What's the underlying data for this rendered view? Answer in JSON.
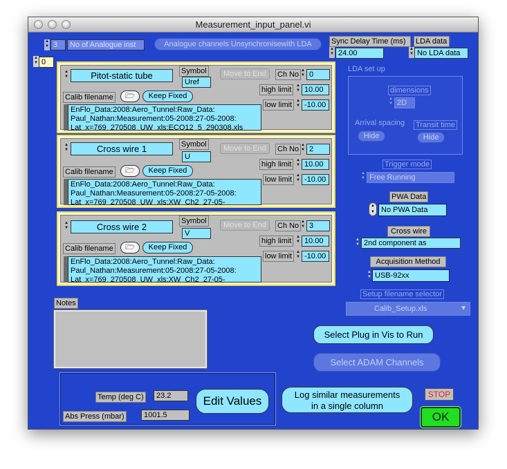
{
  "window": {
    "title": "Measurement_input_panel.vi"
  },
  "top": {
    "analogue_count": "3",
    "analogue_label": "No of Analogue inst",
    "unsync_button": "Analogue channels Unsynchronisewith LDA",
    "index": "0",
    "sync_delay_label": "Sync Delay Time (ms)",
    "sync_delay_value": "24.00",
    "lda_data_label": "LDA data",
    "lda_data_value": "No LDA data"
  },
  "channels": [
    {
      "name": "Pitot-static tube",
      "symbol_label": "Symbol",
      "symbol": "Uref",
      "move_label": "Move to End",
      "chno_label": "Ch No",
      "chno": "0",
      "high_label": "high limit",
      "high": "10.00",
      "low_label": "low limit",
      "low": "-10.00",
      "calib_label": "Calib filename",
      "keep_fixed": "Keep Fixed",
      "path_lines": [
        "EnFlo_Data:2008:Aero_Tunnel:Raw_Data:",
        "Paul_Nathan:Measurement:05-2008:27-05-2008:",
        "Lat_x=769_270508_UW_xls:ECO12_5_290308.xls"
      ]
    },
    {
      "name": "Cross wire 1",
      "symbol_label": "Symbol",
      "symbol": "U",
      "move_label": "Move to End",
      "chno_label": "Ch No",
      "chno": "2",
      "high_label": "high limit",
      "high": "10.00",
      "low_label": "low limit",
      "low": "-10.00",
      "calib_label": "Calib filename",
      "keep_fixed": "Keep Fixed",
      "path_lines": [
        "EnFlo_Data:2008:Aero_Tunnel:Raw_Data:",
        "Paul_Nathan:Measurement:05-2008:27-05-2008:",
        "Lat_x=769_270508_UW_xls:XW_Ch2_27-05-"
      ]
    },
    {
      "name": "Cross wire 2",
      "symbol_label": "Symbol",
      "symbol": "V",
      "move_label": "Move to End",
      "chno_label": "Ch No",
      "chno": "3",
      "high_label": "high limit",
      "high": "10.00",
      "low_label": "low limit",
      "low": "-10.00",
      "calib_label": "Calib filename",
      "keep_fixed": "Keep Fixed",
      "path_lines": [
        "EnFlo_Data:2008:Aero_Tunnel:Raw_Data:",
        "Paul_Nathan:Measurement:05-2008:27-05-2008:",
        "Lat_x=769_270508_UW_xls:XW_Ch2_27-05-"
      ]
    }
  ],
  "lda": {
    "setup_label": "LDA set up",
    "dimensions_label": "dimensions",
    "dimensions_value": "2D",
    "arrival_label": "Arrival spacing",
    "transit_label": "Transit time",
    "hide_label": "Hide"
  },
  "right": {
    "trigger_label": "Trigger mode",
    "trigger_value": "Free Running",
    "pwa_label": "PWA Data",
    "pwa_value": "No PWA Data",
    "crosswire_label": "Cross wire",
    "crosswire_value": "2nd component as",
    "acq_label": "Acquisition Method",
    "acq_value": "USB-92xx",
    "setup_sel_label": "Setup filename selector",
    "setup_sel_value": "Calib_Setup.xls",
    "select_plug": "Select Plug in Vis to Run",
    "select_adam": "Select ADAM Channels"
  },
  "notes": {
    "label": "Notes",
    "value": ""
  },
  "bottom": {
    "temp_label": "Temp (deg C)",
    "temp_value": "23.2",
    "press_label": "Abs Press (mbar)",
    "press_value": "1001.5",
    "edit_values": "Edit Values",
    "log_similar_line1": "Log similar measurements",
    "log_similar_line2": "in a single column",
    "stop": "STOP",
    "ok": "OK"
  },
  "icons": {
    "spinner": "spinner-arrows-icon",
    "folder": "folder-open-icon",
    "ring": "ring-selector-icon",
    "dropdown": "dropdown-triangle-icon"
  },
  "colors": {
    "panel_bg": "#2244cc",
    "field_cyan": "#8fe6ff",
    "ok_green": "#22dd22",
    "stop_red": "#ee2222",
    "channel_frame": "#fff9c6"
  }
}
